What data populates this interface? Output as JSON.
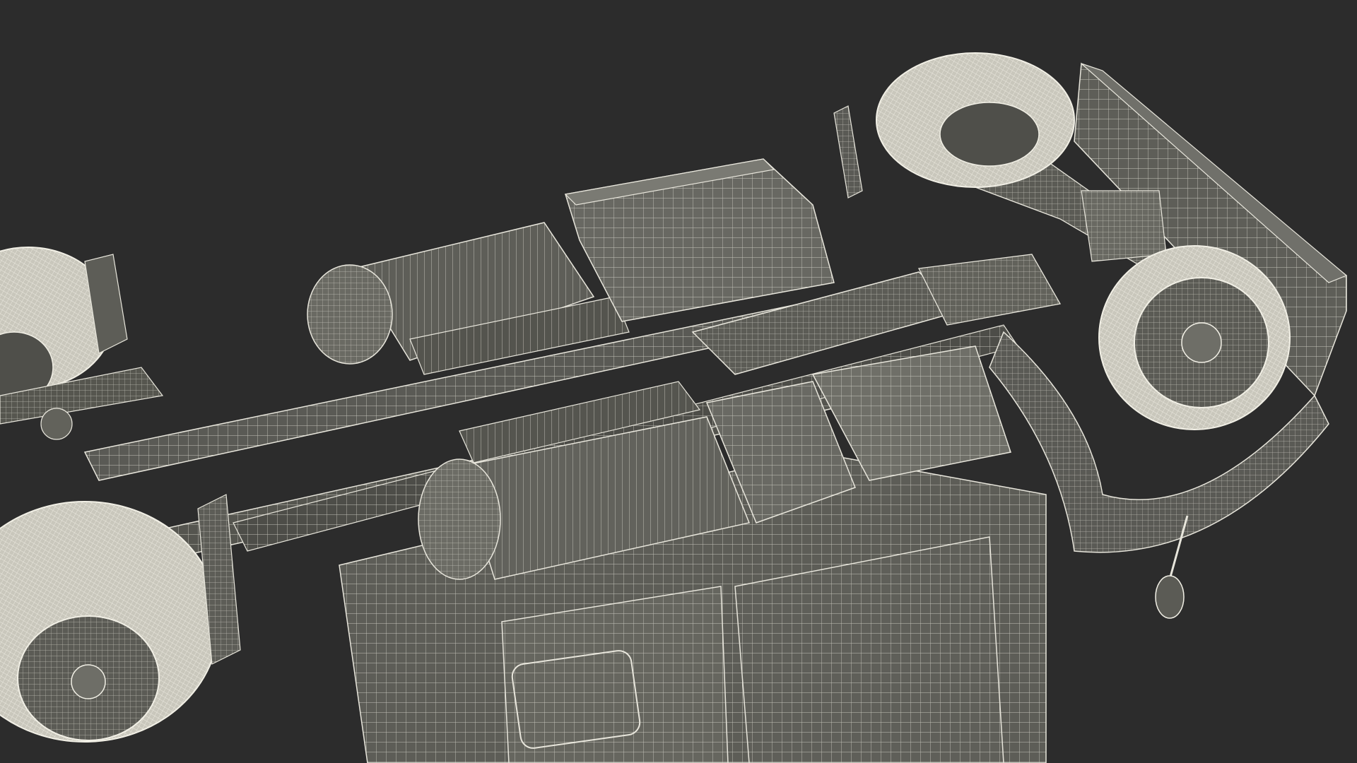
{
  "scene": {
    "subject": "",
    "colors": {
      "background": "#2c2c2c",
      "surface": "#5a5a55",
      "surface_light": "#6e6e68",
      "surface_dark": "#45453f",
      "wire": "#e8e6dc",
      "wire_dim": "#b9b7ad",
      "tire": "#d9d7cc"
    }
  }
}
